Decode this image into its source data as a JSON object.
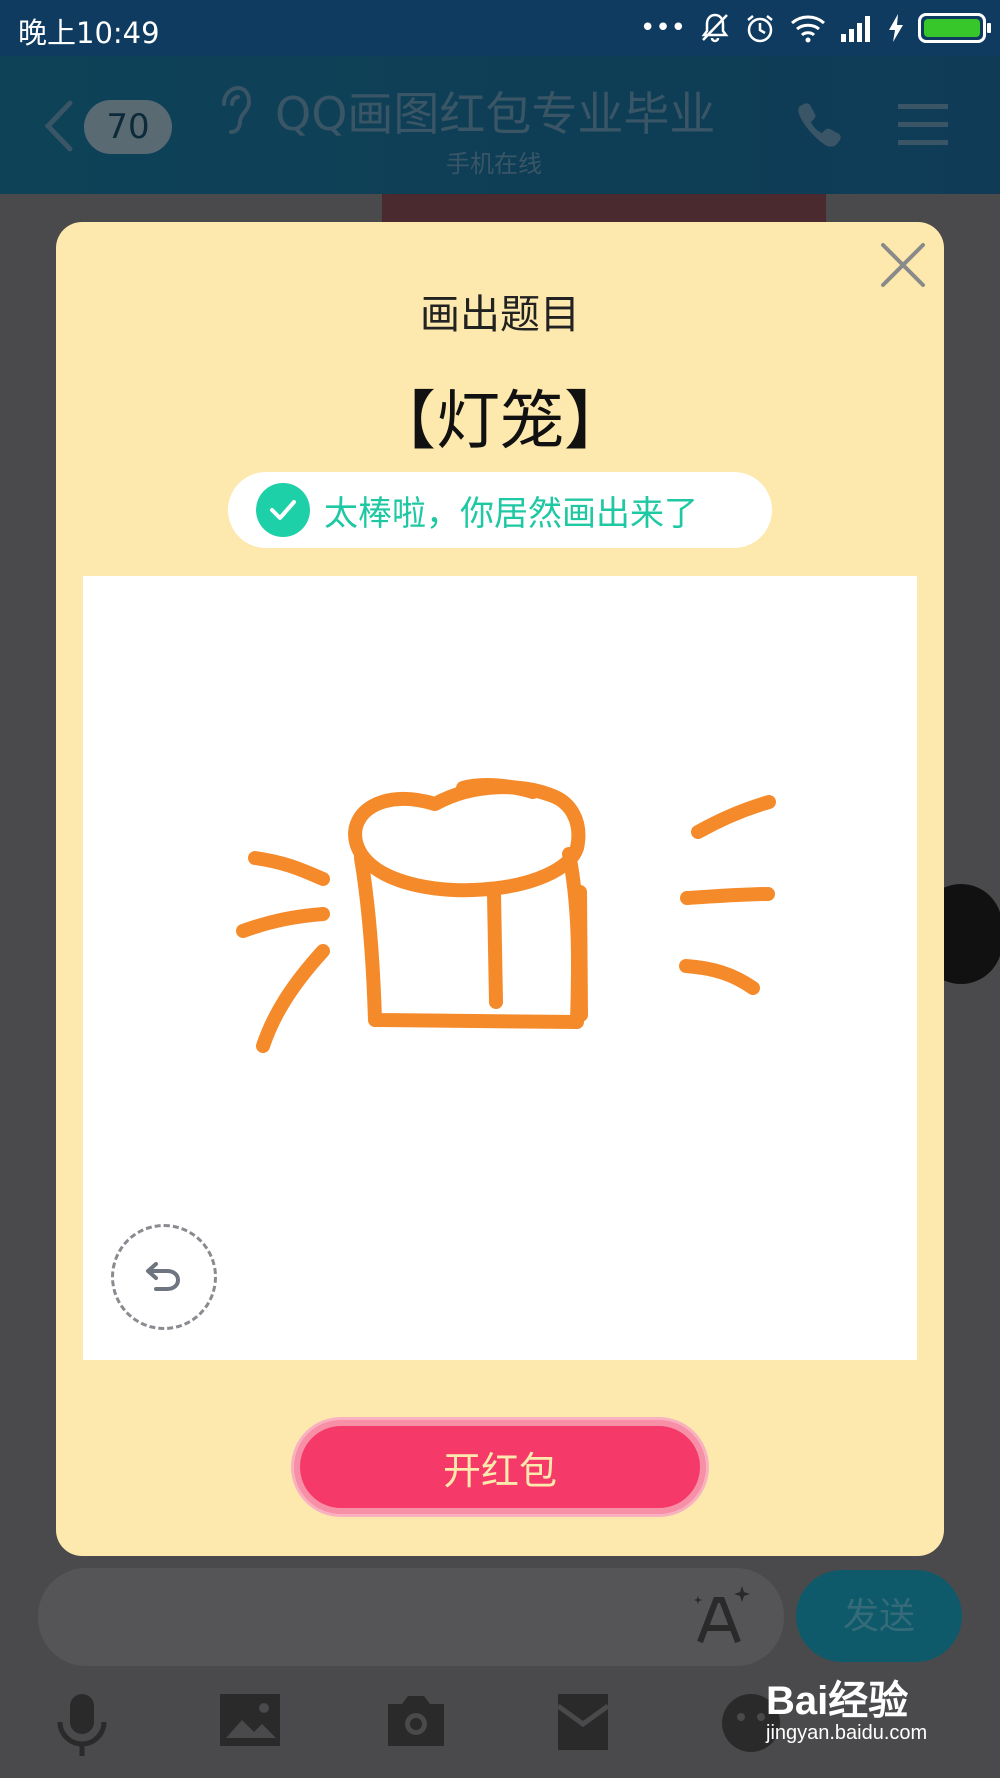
{
  "status_bar": {
    "time": "晚上10:49",
    "dots": "•••"
  },
  "header": {
    "unread_count": "70",
    "title": "QQ画图红包专业毕业",
    "subtitle": "手机在线"
  },
  "modal": {
    "heading": "画出题目",
    "answer": "【灯笼】",
    "success_message": "太棒啦，你居然画出来了",
    "open_button_label": "开红包",
    "drawing_color": "#f58a2a"
  },
  "input_bar": {
    "send_label": "发送"
  },
  "watermark": {
    "logo": "Bai经验",
    "url": "jingyan.baidu.com"
  },
  "colors": {
    "modal_background": "#fde9ad",
    "accent_pink": "#f53a6a",
    "success_green": "#1ed0a8"
  }
}
